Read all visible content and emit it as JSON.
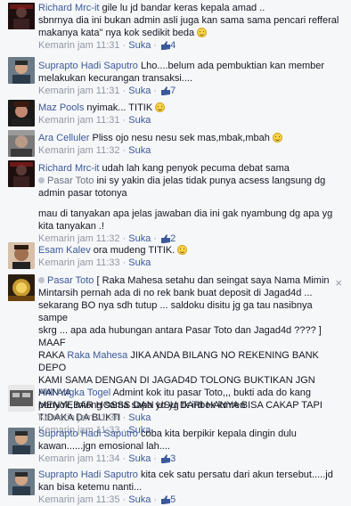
{
  "comments": [
    {
      "name": "Richard Mrc-it",
      "lines": [
        "gile lu jd bandar keras kepala amad ..",
        "sbnrnya dia ini bukan admin asli juga kan sama sama pencari refferal",
        "makanya kata\" nya kok sedikit beda"
      ],
      "time": "Kemarin jam 11:31",
      "like": "Suka",
      "count": "4"
    },
    {
      "name": "Suprapto Hadi Saputro",
      "lines": [
        "Lho....belum ada pembuktian kan member",
        "melakukan kecurangan transaksi...."
      ],
      "time": "Kemarin jam 11:31",
      "like": "Suka",
      "count": "7"
    },
    {
      "name": "Maz Pools",
      "lines": [
        "nyimak... TITIK"
      ],
      "time": "Kemarin jam 11:31",
      "like": "Suka",
      "count": ""
    },
    {
      "name": "Ara Celluler",
      "lines": [
        "Pliss ojo nesu nesu sek mas,mbak,mbah"
      ],
      "time": "Kemarin jam 11:32",
      "like": "Suka",
      "count": ""
    },
    {
      "name": "Richard Mrc-it",
      "lines": [
        "udah lah kang penyok pecuma debat sama"
      ],
      "reply_to": "Pasar Toto",
      "reply_lines": [
        "ini sy yakin dia jelas tidak punya acsess langsung dg",
        "admin pasar totonya"
      ],
      "extra_lines": [
        "mau di tanyakan apa jelas jawaban dia ini gak nyambung dg apa yg",
        "kita tanyakan .!"
      ],
      "time": "Kemarin jam 11:32",
      "like": "Suka",
      "count": "2"
    },
    {
      "name": "Esam Kalev",
      "lines": [
        "ora mudeng TITIK."
      ],
      "time": "Kemarin jam 11:33",
      "like": "Suka",
      "count": ""
    },
    {
      "name": "Pasar Toto",
      "lines": [
        "[ Raka Mahesa setahu dan seingat saya Nama Mimin",
        "Mintarsih pernah ada di no rek bank buat deposit di Jagad4d ...",
        "sekarang BO nya sdh tutup ... saldoku disitu jg ga tau nasibnya sampe",
        "skrg ... apa ada hubungan antara Pasar Toto dan Jagad4d ???? ] MAAF",
        "RAKA",
        "KAMI SAMA DENGAN DI JAGAD4D TOLONG BUKTIKAN JGN HANYA",
        "MENYEBAR HOSSS DAN USU DARI HANYA BISA CAKAP TAPI",
        "TIDAKA DA BUKTI"
      ],
      "mention": "Raka Mahesa",
      "mention_rest": "JIKA ANDA BILANG NO REKENING BANK DEPO",
      "time": "Kemarin jam 11:33",
      "like": "Suka",
      "count": ""
    },
    {
      "name": "Ahli Angka Togel",
      "lines": [
        "Admint kok itu pasar Toto,,, bukti ada do kang",
        "penyok, miong sama sapa yo yg tk inbox kmren"
      ],
      "time": "Kemarin jam 11:34",
      "like": "Suka",
      "count": ""
    },
    {
      "name": "Suprapto Hadi Saputro",
      "lines": [
        "coba kita berpikir kepala dingin dulu",
        "kawan......jgn emosional lah...."
      ],
      "time": "Kemarin jam 11:34",
      "like": "Suka",
      "count": "3"
    },
    {
      "name": "Suprapto Hadi Saputro",
      "lines": [
        "kita cek satu persatu dari akun tersebut.....jd",
        "kan bisa ketemu nanti..."
      ],
      "time": "Kemarin jam 11:35",
      "like": "Suka",
      "count": "5"
    }
  ],
  "close_label": "×",
  "colors": {
    "link": "#3b5998",
    "meta": "#9197a3",
    "bg": "#f6f7f9"
  }
}
